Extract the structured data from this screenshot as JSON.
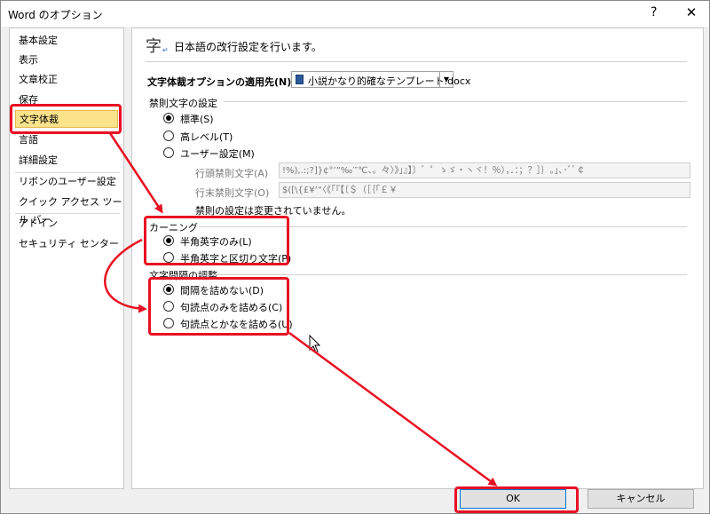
{
  "window": {
    "title": "Word のオプション",
    "help": "?",
    "close": "✕"
  },
  "sidebar": {
    "items": [
      {
        "label": "基本設定"
      },
      {
        "label": "表示"
      },
      {
        "label": "文章校正"
      },
      {
        "label": "保存"
      },
      {
        "label": "文字体裁",
        "selected": true
      },
      {
        "label": "言語"
      },
      {
        "label": "詳細設定"
      },
      {
        "label": "リボンのユーザー設定"
      },
      {
        "label": "クイック アクセス ツール バー"
      },
      {
        "label": "アドイン"
      },
      {
        "label": "セキュリティ センター"
      }
    ]
  },
  "content": {
    "header_icon": "字",
    "header_text": "日本語の改行設定を行います。",
    "apply_to_label": "文字体裁オプションの適用先(N):",
    "apply_to_value": "小説かなり的確なテンプレート.docx",
    "kinsoku": {
      "heading": "禁則文字の設定",
      "options": [
        "標準(S)",
        "高レベル(T)",
        "ユーザー設定(M)"
      ],
      "selected": 0,
      "not_begin_label": "行頭禁則文字(A)",
      "not_begin_value": "!%),.:;?]}¢°’”‰′″℃、。々〉》」』】〕゛゜ゝゞ・ヽヾ！％），．：；？］｝｡｣､･ﾞﾟ￠",
      "not_end_label": "行末禁則文字(O)",
      "not_end_value": "$([\\{£¥‘“〈《「『【〔＄（［｛｢￡￥",
      "note": "禁則の設定は変更されていません。"
    },
    "kerning": {
      "heading": "カーニング",
      "options": [
        "半角英字のみ(L)",
        "半角英字と区切り文字(P)"
      ],
      "selected": 0
    },
    "spacing": {
      "heading": "文字間隔の調整",
      "options": [
        "間隔を詰めない(D)",
        "句読点のみを詰める(C)",
        "句読点とかなを詰める(U)"
      ],
      "selected": 0
    }
  },
  "buttons": {
    "ok": "OK",
    "cancel": "キャンセル"
  },
  "colors": {
    "annotation": "#e81123",
    "selected_item": "#fbe38c",
    "accent": "#0078d7"
  }
}
